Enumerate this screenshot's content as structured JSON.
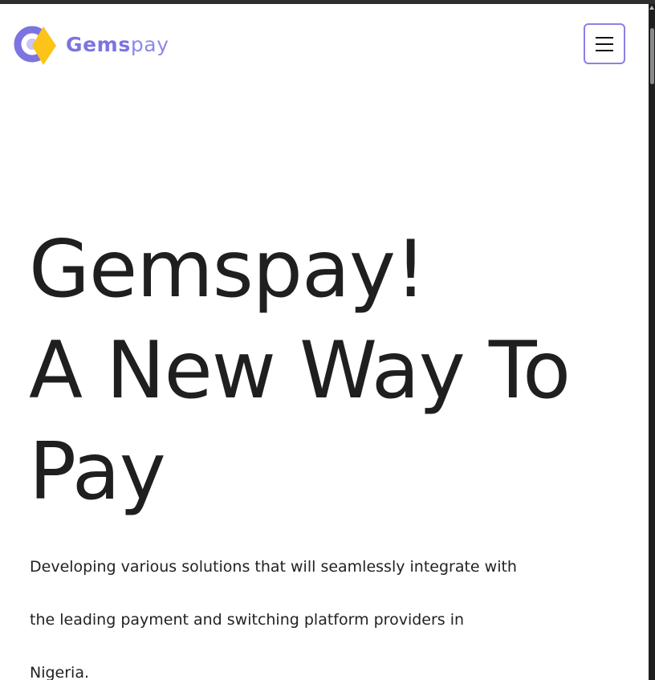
{
  "brand": {
    "name_bold": "Gems",
    "name_light": "pay",
    "logo_icon": "gemspay-logo-icon",
    "colors": {
      "primary": "#7c74e0",
      "accent": "#fcc419"
    }
  },
  "header": {
    "menu_button_icon": "hamburger-menu-icon"
  },
  "hero": {
    "title_lines": [
      "Gemspay!",
      "A New Way To",
      "Pay"
    ],
    "description_lines": [
      "Developing various solutions that will seamlessly integrate with",
      "the leading payment and switching platform providers in",
      "Nigeria."
    ]
  }
}
